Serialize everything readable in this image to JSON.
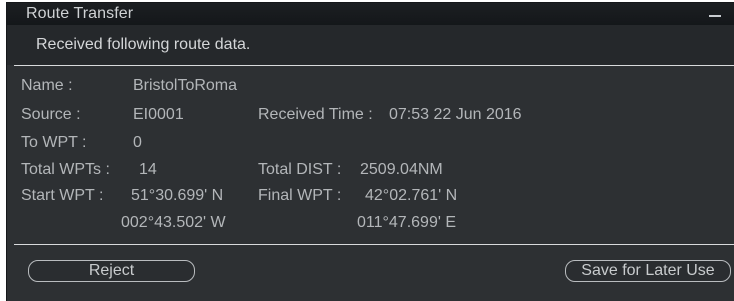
{
  "window": {
    "title": "Route Transfer",
    "message": "Received following route data."
  },
  "fields": {
    "name_label": "Name :",
    "name_value": "BristolToRoma",
    "source_label": "Source :",
    "source_value": "EI0001",
    "received_time_label": "Received Time :",
    "received_time_value": "07:53  22 Jun 2016",
    "to_wpt_label": "To WPT :",
    "to_wpt_value": "0",
    "total_wpts_label": "Total WPTs :",
    "total_wpts_value": "14",
    "total_dist_label": "Total DIST :",
    "total_dist_value": "2509.04NM",
    "start_wpt_label": "Start WPT :",
    "start_wpt_lat": "51°30.699' N",
    "start_wpt_lon": "002°43.502' W",
    "final_wpt_label": "Final WPT :",
    "final_wpt_lat": "42°02.761' N",
    "final_wpt_lon": "011°47.699' E"
  },
  "buttons": {
    "reject": "Reject",
    "save_later": "Save for Later Use"
  },
  "colors": {
    "window_bg": "#2d3033",
    "titlebar_bg": "#1c1f22",
    "text": "#b3b6b9"
  }
}
